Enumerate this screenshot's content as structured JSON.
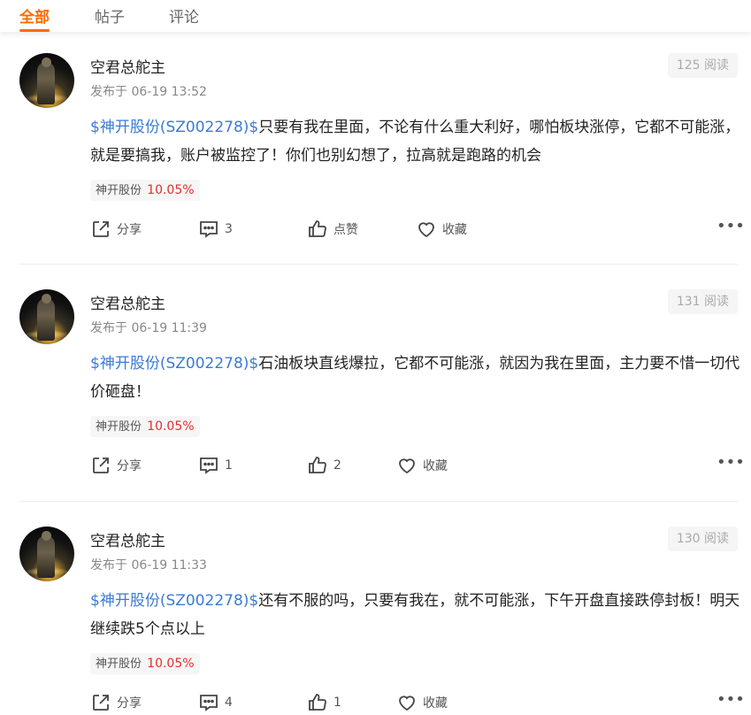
{
  "tabs": [
    {
      "label": "全部"
    },
    {
      "label": "帖子"
    },
    {
      "label": "评论"
    }
  ],
  "posts": [
    {
      "author": "空君总舵主",
      "time": "发布于 06-19 13:52",
      "reads": "125 阅读",
      "stock_link": "$神开股份(SZ002278)$",
      "text": "只要有我在里面，不论有什么重大利好，哪怕板块涨停，它都不可能涨，就是要搞我，账户被监控了！你们也别幻想了，拉高就是跑路的机会",
      "tag_name": "神开股份",
      "tag_change": "10.05%",
      "share_label": "分享",
      "comments": "3",
      "likes": "点赞",
      "collect_label": "收藏"
    },
    {
      "author": "空君总舵主",
      "time": "发布于 06-19 11:39",
      "reads": "131 阅读",
      "stock_link": "$神开股份(SZ002278)$",
      "text": "石油板块直线爆拉，它都不可能涨，就因为我在里面，主力要不惜一切代价砸盘！",
      "tag_name": "神开股份",
      "tag_change": "10.05%",
      "share_label": "分享",
      "comments": "1",
      "likes": "2",
      "collect_label": "收藏"
    },
    {
      "author": "空君总舵主",
      "time": "发布于 06-19 11:33",
      "reads": "130 阅读",
      "stock_link": "$神开股份(SZ002278)$",
      "text": "还有不服的吗，只要有我在，就不可能涨，下午开盘直接跌停封板！明天继续跌5个点以上",
      "tag_name": "神开股份",
      "tag_change": "10.05%",
      "share_label": "分享",
      "comments": "4",
      "likes": "1",
      "collect_label": "收藏"
    }
  ],
  "colors": {
    "accent": "#ff6a00",
    "link": "#3b7bd4",
    "rise": "#e62d2d"
  }
}
